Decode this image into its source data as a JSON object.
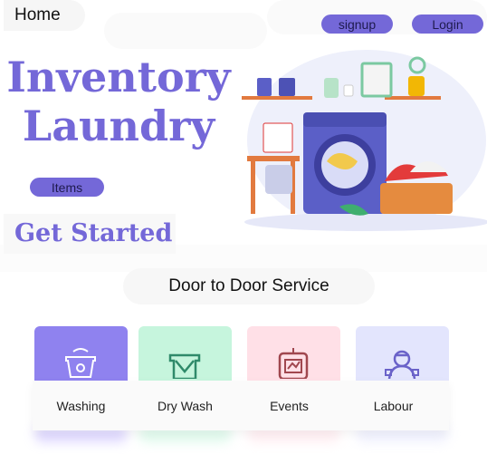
{
  "nav": {
    "home": "Home",
    "signup": "signup",
    "login": "Login"
  },
  "hero": {
    "title_line1": "Inventory",
    "title_line2": "Laundry",
    "items_button": "Items",
    "get_started": "Get Started"
  },
  "services": {
    "heading": "Door to Door Service",
    "cards": [
      {
        "label": "Washing",
        "icon": "washing-basin-icon",
        "color": "#8f82ef"
      },
      {
        "label": "Dry Wash",
        "icon": "hanger-shirt-icon",
        "color": "#c6f5dd"
      },
      {
        "label": "Events",
        "icon": "calendar-tv-icon",
        "color": "#ffe0e7"
      },
      {
        "label": "Labour",
        "icon": "worker-icon",
        "color": "#e3e5fd"
      }
    ]
  },
  "theme": {
    "accent": "#7468d8"
  }
}
